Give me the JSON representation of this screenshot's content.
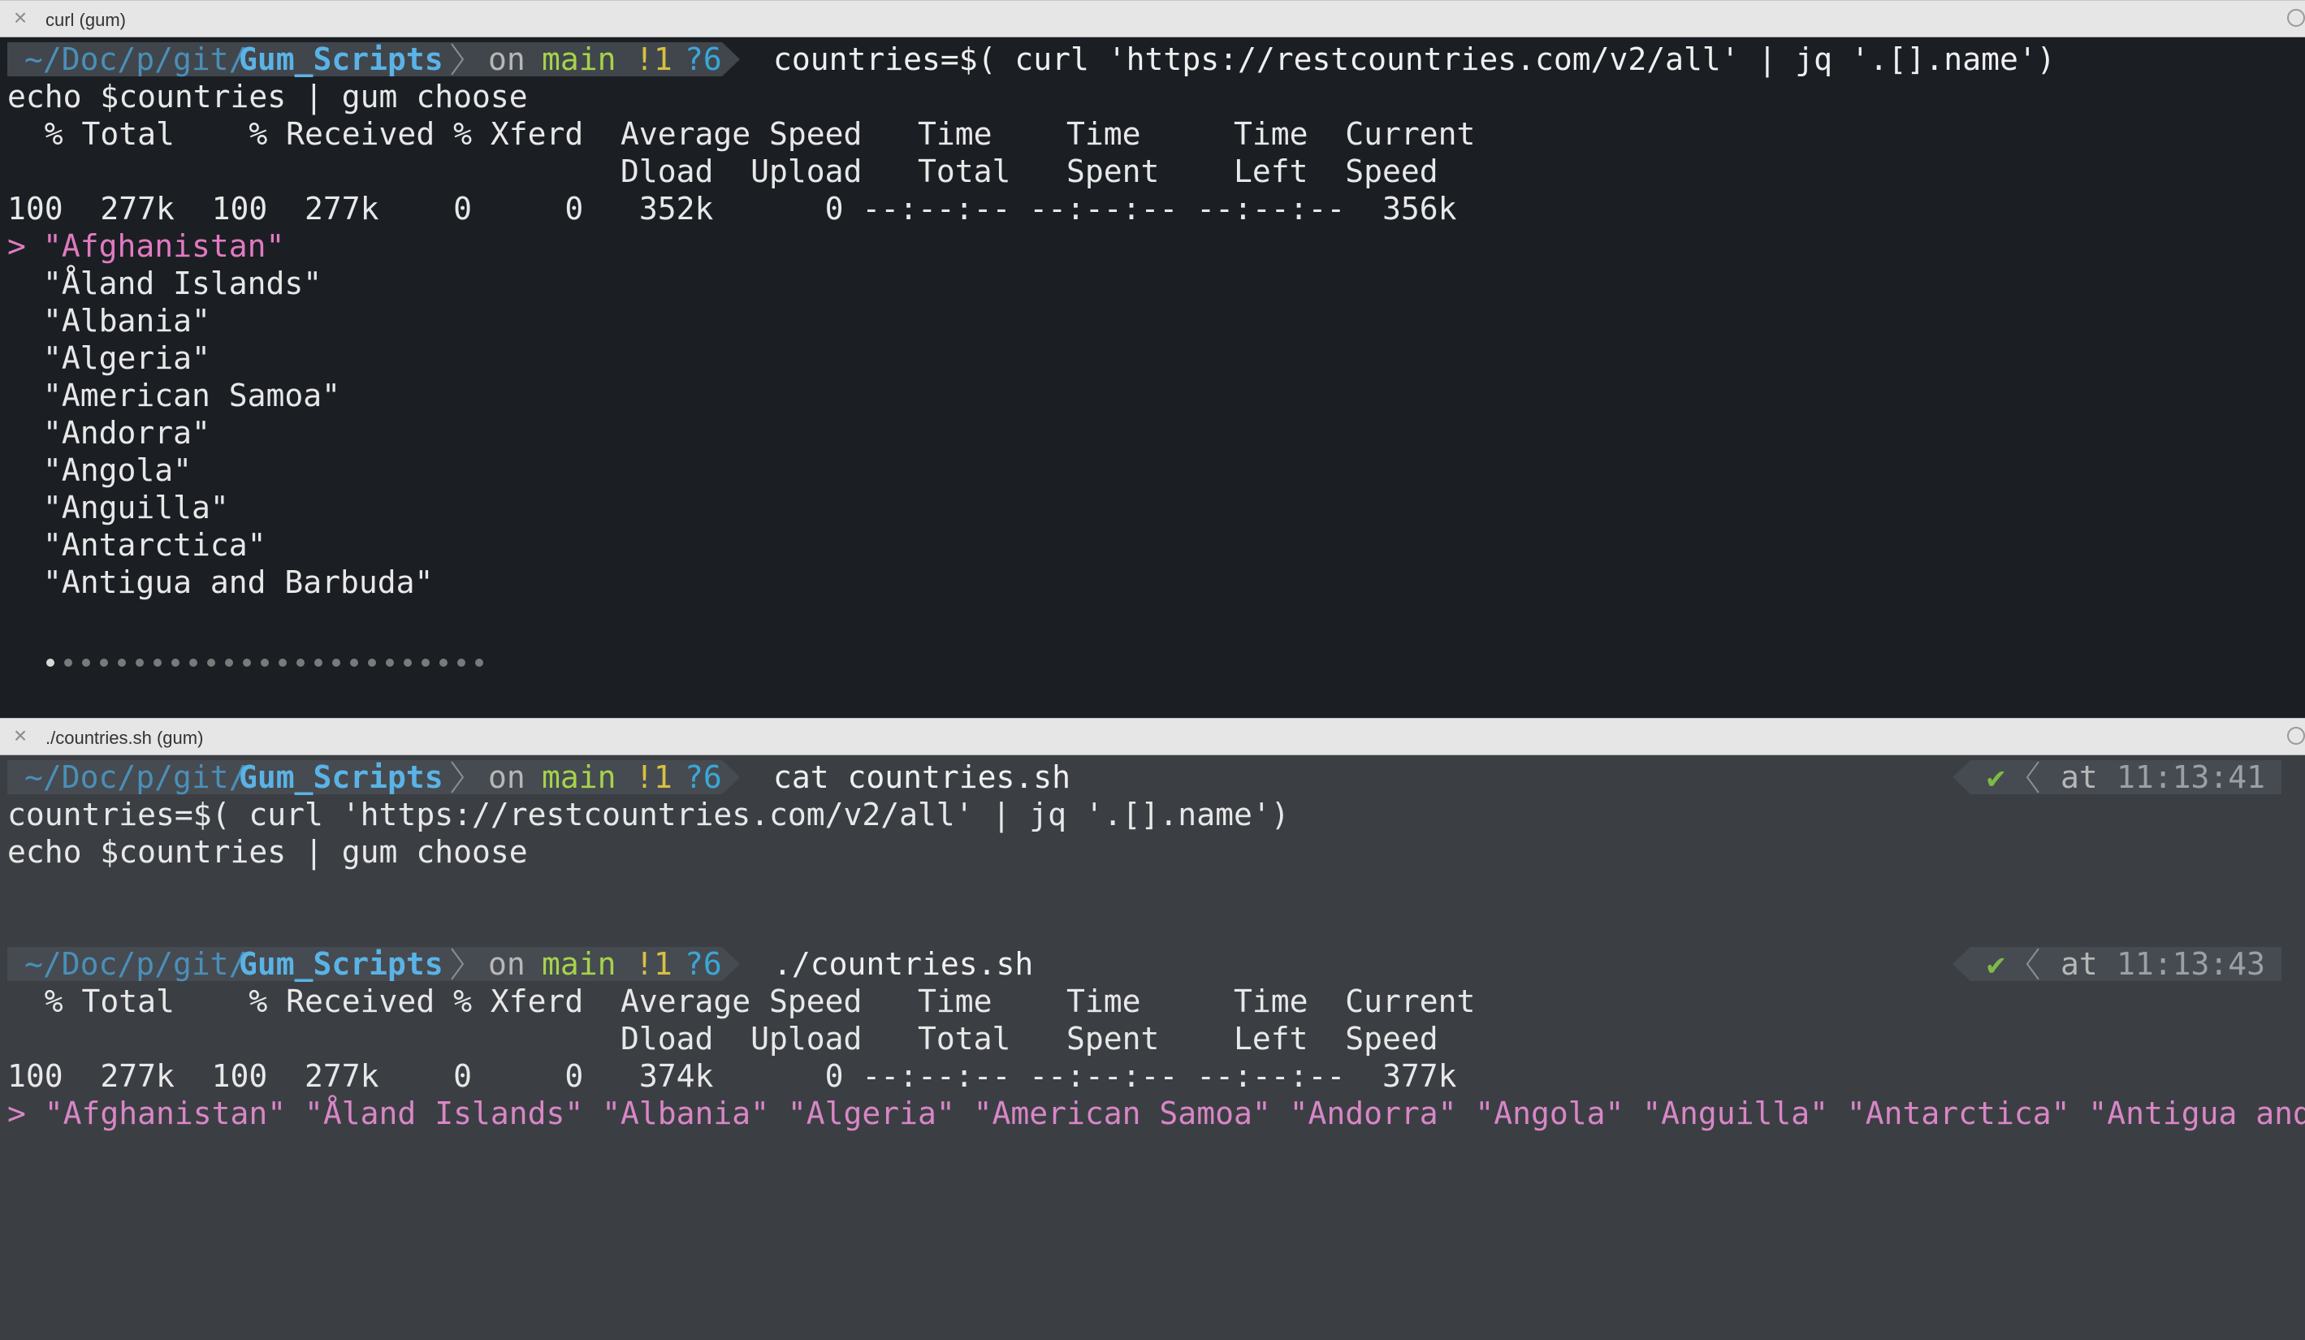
{
  "top_pane": {
    "title": "curl (gum)",
    "prompt": {
      "path_prefix": "~/Doc/p/git/",
      "path_dir": "Gum_Scripts",
      "on": "on",
      "branch": "main",
      "git_modified": "!1",
      "git_untracked": "?6",
      "command": "countries=$( curl 'https://restcountries.com/v2/all' | jq '.[].name')"
    },
    "lines": [
      "echo $countries | gum choose",
      "  % Total    % Received % Xferd  Average Speed   Time    Time     Time  Current",
      "                                 Dload  Upload   Total   Spent    Left  Speed",
      "100  277k  100  277k    0     0   352k      0 --:--:-- --:--:-- --:--:--  356k"
    ],
    "cursor": "> ",
    "selected_item": "\"Afghanistan\"",
    "items": [
      "\"Åland Islands\"",
      "\"Albania\"",
      "\"Algeria\"",
      "\"American Samoa\"",
      "\"Andorra\"",
      "\"Angola\"",
      "\"Anguilla\"",
      "\"Antarctica\"",
      "\"Antigua and Barbuda\""
    ]
  },
  "bottom_pane": {
    "title": "./countries.sh (gum)",
    "prompt1": {
      "path_prefix": "~/Doc/p/git/",
      "path_dir": "Gum_Scripts",
      "on": "on",
      "branch": "main",
      "git_modified": "!1",
      "git_untracked": "?6",
      "command": "cat countries.sh",
      "status": "✔",
      "at": "at",
      "time": "11:13:41"
    },
    "file_lines": [
      "countries=$( curl 'https://restcountries.com/v2/all' | jq '.[].name')",
      "echo $countries | gum choose"
    ],
    "prompt2": {
      "path_prefix": "~/Doc/p/git/",
      "path_dir": "Gum_Scripts",
      "on": "on",
      "branch": "main",
      "git_modified": "!1",
      "git_untracked": "?6",
      "command": "./countries.sh",
      "status": "✔",
      "at": "at",
      "time": "11:13:43"
    },
    "curl_lines": [
      "  % Total    % Received % Xferd  Average Speed   Time    Time     Time  Current",
      "                                 Dload  Upload   Total   Spent    Left  Speed",
      "100  277k  100  277k    0     0   374k      0 --:--:-- --:--:-- --:--:--  377k"
    ],
    "choose_line": "> \"Afghanistan\" \"Åland Islands\" \"Albania\" \"Algeria\" \"American Samoa\" \"Andorra\" \"Angola\" \"Anguilla\" \"Antarctica\" \"Antigua and Bar"
  },
  "colors": {
    "top_bg": "#1b1f24",
    "bottom_bg": "#3b3f44",
    "selected": "#e27ac1",
    "branch": "#a6d34a"
  }
}
